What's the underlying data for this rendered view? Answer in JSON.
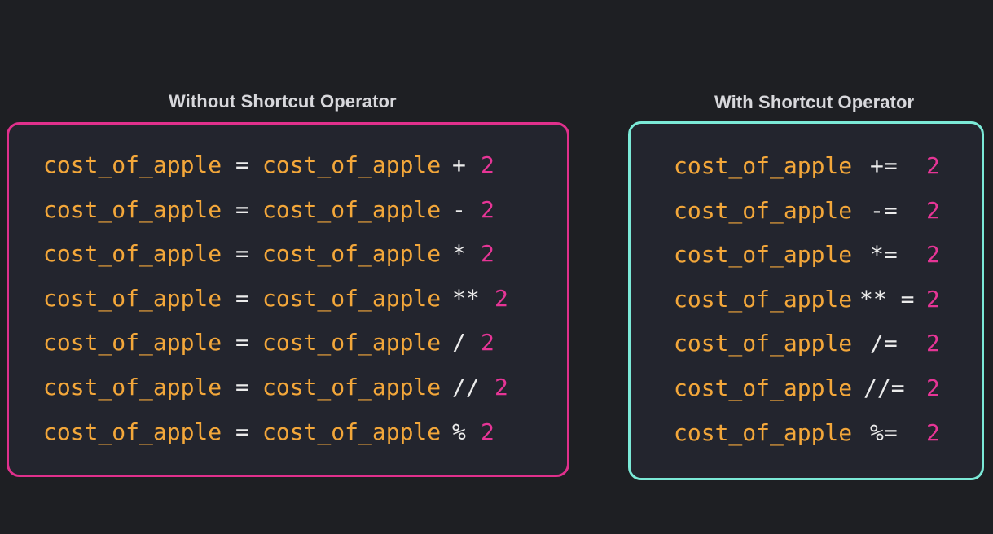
{
  "left": {
    "title": "Without Shortcut Operator",
    "accent": "#e0308c",
    "lines": [
      {
        "var": "cost_of_apple",
        "eq": "=",
        "var2": "cost_of_apple",
        "op": "+",
        "num": "2"
      },
      {
        "var": "cost_of_apple",
        "eq": "=",
        "var2": "cost_of_apple",
        "op": "-",
        "num": "2"
      },
      {
        "var": "cost_of_apple",
        "eq": "=",
        "var2": "cost_of_apple",
        "op": "*",
        "num": "2"
      },
      {
        "var": "cost_of_apple",
        "eq": "=",
        "var2": "cost_of_apple",
        "op": "**",
        "num": "2"
      },
      {
        "var": "cost_of_apple",
        "eq": "=",
        "var2": "cost_of_apple",
        "op": "/",
        "num": "2"
      },
      {
        "var": "cost_of_apple",
        "eq": "=",
        "var2": "cost_of_apple",
        "op": "//",
        "num": "2"
      },
      {
        "var": "cost_of_apple",
        "eq": "=",
        "var2": "cost_of_apple",
        "op": "%",
        "num": "2"
      }
    ]
  },
  "right": {
    "title": "With Shortcut Operator",
    "accent": "#7be9d7",
    "lines": [
      {
        "var": "cost_of_apple",
        "op": "+=",
        "num": "2"
      },
      {
        "var": "cost_of_apple",
        "op": "-=",
        "num": "2"
      },
      {
        "var": "cost_of_apple",
        "op": "*=",
        "num": "2"
      },
      {
        "var": "cost_of_apple",
        "op": "** =",
        "num": "2"
      },
      {
        "var": "cost_of_apple",
        "op": "/=",
        "num": "2"
      },
      {
        "var": "cost_of_apple",
        "op": "//=",
        "num": "2"
      },
      {
        "var": "cost_of_apple",
        "op": "%=",
        "num": "2"
      }
    ]
  }
}
